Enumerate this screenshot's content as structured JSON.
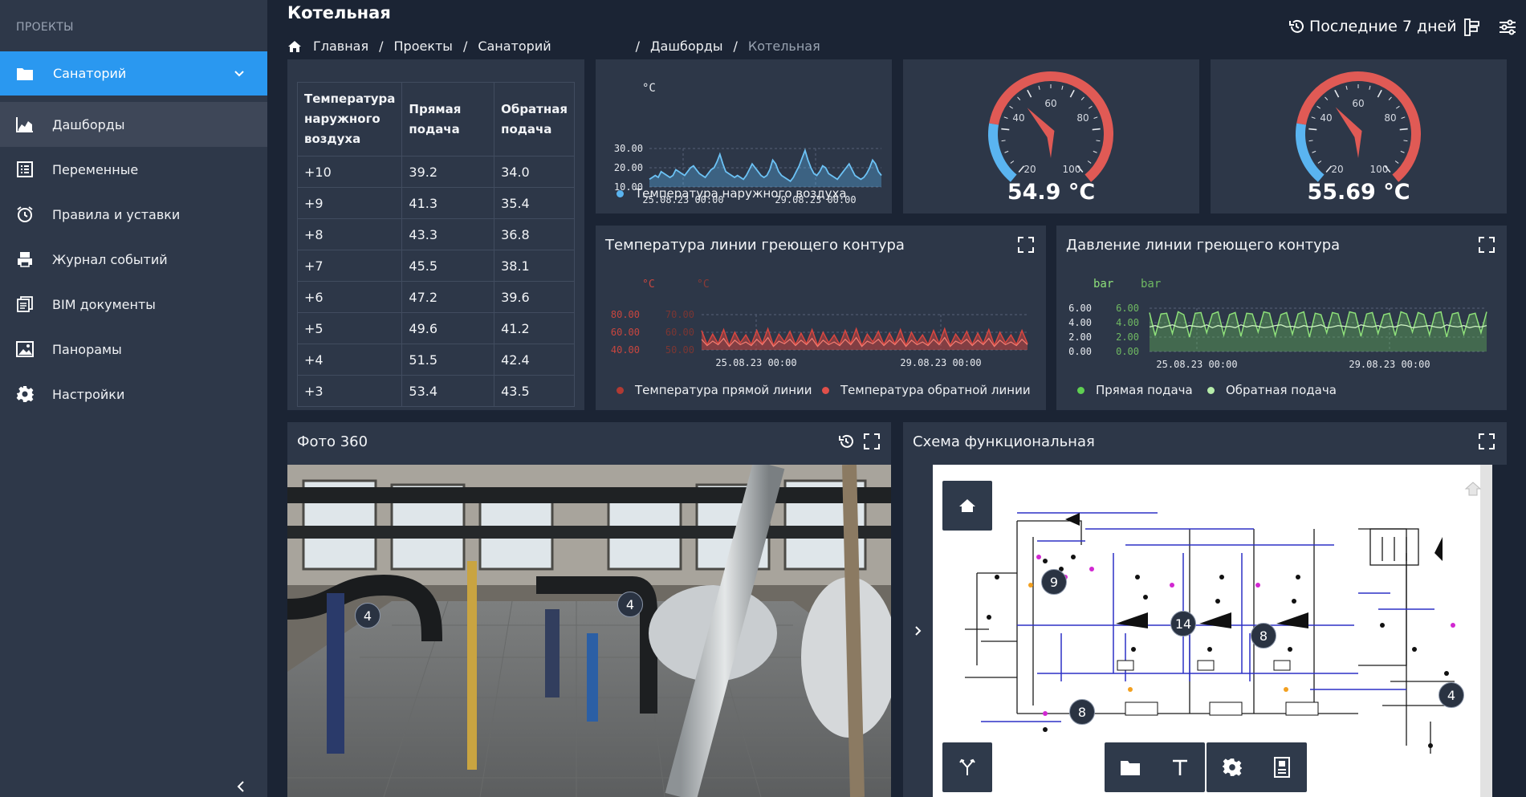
{
  "sidebar": {
    "header": "ПРОЕКТЫ",
    "project": {
      "label": "Санаторий"
    },
    "items": [
      {
        "label": "Дашборды",
        "icon": "chart-area-icon",
        "active": true
      },
      {
        "label": "Переменные",
        "icon": "list-icon",
        "active": false
      },
      {
        "label": "Правила и уставки",
        "icon": "alarm-clock-icon",
        "active": false
      },
      {
        "label": "Журнал событий",
        "icon": "printer-icon",
        "active": false
      },
      {
        "label": "BIM документы",
        "icon": "documents-icon",
        "active": false
      },
      {
        "label": "Панорамы",
        "icon": "image-icon",
        "active": false
      },
      {
        "label": "Настройки",
        "icon": "gear-icon",
        "active": false
      }
    ]
  },
  "header": {
    "title": "Котельная",
    "breadcrumbs": [
      "Главная",
      "Проекты",
      "Санаторий",
      "Дашборды",
      "Котельная"
    ],
    "time_range": "Последние 7 дней"
  },
  "table": {
    "headers": [
      "Температура наружного воздуха",
      "Прямая подача",
      "Обратная подача"
    ],
    "rows": [
      [
        "+10",
        "39.2",
        "34.0"
      ],
      [
        "+9",
        "41.3",
        "35.4"
      ],
      [
        "+8",
        "43.3",
        "36.8"
      ],
      [
        "+7",
        "45.5",
        "38.1"
      ],
      [
        "+6",
        "47.2",
        "39.6"
      ],
      [
        "+5",
        "49.6",
        "41.2"
      ],
      [
        "+4",
        "51.5",
        "42.4"
      ],
      [
        "+3",
        "53.4",
        "43.5"
      ]
    ]
  },
  "outdoor_chart": {
    "unit": "°C",
    "legend": "Температура наружного воздуха"
  },
  "gauges": [
    {
      "value": "54.9 °C",
      "ticks": [
        "20",
        "40",
        "60",
        "80",
        "100"
      ]
    },
    {
      "value": "55.69 °C",
      "ticks": [
        "20",
        "40",
        "60",
        "80",
        "100"
      ]
    }
  ],
  "temp_chart": {
    "title": "Температура линии греющего контура",
    "units": [
      "°C",
      "°C"
    ],
    "legend": [
      "Температура прямой линии",
      "Температура обратной линии"
    ]
  },
  "pressure_chart": {
    "title": "Давление линии греющего контура",
    "units": [
      "bar",
      "bar"
    ],
    "legend": [
      "Прямая подача",
      "Обратная подача"
    ]
  },
  "photo": {
    "title": "Фото 360",
    "markers": [
      "4",
      "4"
    ]
  },
  "schema": {
    "title": "Схема функциональная",
    "markers": [
      "9",
      "14",
      "8",
      "8",
      "4"
    ]
  },
  "colors": {
    "accent": "#2a98f0",
    "background": "#1b2434",
    "panel": "#2d3748",
    "sidebar": "#2e3849",
    "line_blue": "#5ab4f0",
    "line_red": "#e0504a",
    "line_green": "#8ee07a"
  },
  "chart_data": [
    {
      "type": "line",
      "x_ticks": [
        "25.08.23 00:00",
        "29.08.23 00:00"
      ],
      "y_ticks": [
        "30.00",
        "20.00",
        "10.00"
      ],
      "ylim": [
        10,
        30
      ],
      "ylabel": "°C",
      "series": [
        {
          "name": "Температура наружного воздуха",
          "values": [
            14,
            15,
            16,
            15,
            18,
            17,
            16,
            15,
            16,
            19,
            18,
            17,
            16,
            18,
            20,
            21,
            19,
            17,
            16,
            15,
            17,
            19,
            20,
            23,
            27,
            22,
            18,
            17,
            16,
            15,
            16,
            15,
            14,
            16,
            19,
            22,
            20,
            18,
            16,
            15,
            16,
            19,
            24,
            22,
            18,
            16,
            15,
            14,
            13,
            15,
            18,
            21,
            25,
            29,
            24,
            20,
            17,
            16,
            18,
            21,
            20,
            17,
            16,
            15,
            14,
            16,
            18,
            20,
            22,
            19,
            16,
            15,
            14,
            15,
            17,
            20,
            24,
            22,
            18,
            16
          ]
        }
      ]
    },
    {
      "type": "line",
      "x_ticks": [
        "25.08.23 00:00",
        "29.08.23 00:00"
      ],
      "y_ticks": [
        "80.00",
        "60.00",
        "40.00"
      ],
      "ylim": [
        40,
        80
      ],
      "ylabel": "°C",
      "series": [
        {
          "name": "Температура прямой линии",
          "values": [
            62,
            46,
            58,
            47,
            63,
            45,
            60,
            48,
            57,
            46,
            62,
            47,
            64,
            45,
            58,
            49,
            61,
            46,
            59,
            47,
            63,
            45,
            60,
            48,
            57,
            46,
            62,
            47,
            64,
            45,
            58,
            49,
            61,
            46,
            59,
            47,
            63,
            45,
            60,
            48,
            57,
            46,
            62,
            47,
            64,
            45,
            58,
            49,
            61,
            46,
            59,
            47,
            63,
            45,
            60,
            48,
            57,
            46,
            62,
            47
          ]
        },
        {
          "name": "Температура обратной линии",
          "values": [
            52,
            45,
            50,
            46,
            53,
            44,
            51,
            46,
            49,
            45,
            52,
            46,
            54,
            44,
            50,
            47,
            52,
            45,
            51,
            46,
            53,
            44,
            51,
            46,
            49,
            45,
            52,
            46,
            54,
            44,
            50,
            47,
            52,
            45,
            51,
            46,
            53,
            44,
            51,
            46,
            49,
            45,
            52,
            46,
            54,
            44,
            50,
            47,
            52,
            45,
            51,
            46,
            53,
            44,
            51,
            46,
            49,
            45,
            52,
            46
          ]
        }
      ]
    },
    {
      "type": "line",
      "x_ticks": [
        "25.08.23 00:00",
        "29.08.23 00:00"
      ],
      "y_ticks": [
        "6.00",
        "4.00",
        "2.00",
        "0.00"
      ],
      "ylim": [
        0,
        6
      ],
      "ylabel": "bar",
      "series": [
        {
          "name": "Прямая подача",
          "values": [
            5.4,
            2.2,
            5.2,
            5.3,
            2.5,
            5.5,
            5.1,
            2.0,
            5.3,
            5.4,
            2.6,
            5.2,
            5.5,
            2.3,
            5.1,
            5.4,
            2.1,
            5.3,
            5.2,
            2.7,
            5.5,
            5.3,
            2.2,
            5.1,
            5.4,
            2.4,
            5.2,
            5.5,
            2.0,
            5.3,
            5.1,
            2.6,
            5.4,
            5.2,
            2.3,
            5.5,
            5.3,
            2.1,
            5.2,
            5.4,
            2.5,
            5.1,
            5.3,
            2.2,
            5.5,
            5.2,
            2.7,
            5.4,
            5.1,
            2.3,
            5.3,
            5.5,
            2.0,
            5.2,
            5.4,
            2.4,
            5.1,
            5.3,
            2.6,
            5.5
          ]
        },
        {
          "name": "Обратная подача",
          "values": [
            3.4,
            3.6,
            3.3,
            3.5,
            3.7,
            3.4,
            3.3,
            3.6,
            3.5,
            3.4,
            3.7,
            3.3,
            3.6,
            3.4,
            3.5,
            3.3,
            3.7,
            3.4,
            3.6,
            3.5,
            3.3,
            3.4,
            3.6,
            3.7,
            3.4,
            3.5,
            3.3,
            3.6,
            3.4,
            3.5,
            3.7,
            3.3,
            3.4,
            3.6,
            3.5,
            3.4,
            3.3,
            3.7,
            3.5,
            3.4,
            3.6,
            3.3,
            3.5,
            3.4,
            3.7,
            3.6,
            3.3,
            3.4,
            3.5,
            3.6,
            3.4,
            3.3,
            3.7,
            3.5,
            3.4,
            3.6,
            3.3,
            3.5,
            3.4,
            3.6
          ]
        }
      ]
    }
  ]
}
